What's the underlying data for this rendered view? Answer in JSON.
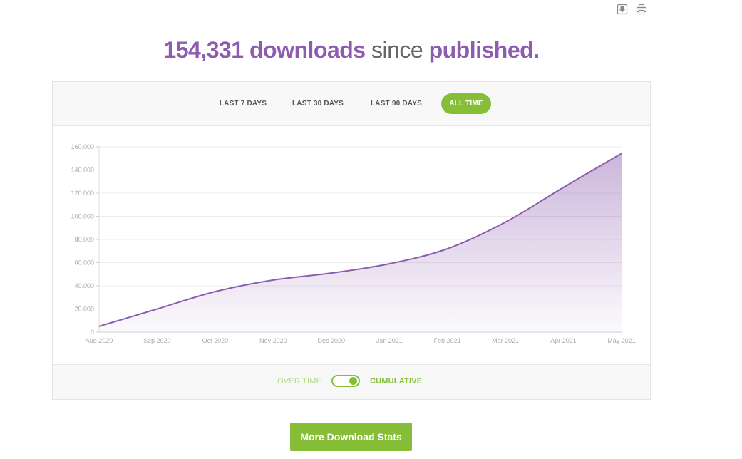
{
  "toolbar": {
    "icons": [
      "download-icon",
      "print-icon"
    ]
  },
  "headline": {
    "count": "154,331",
    "word_downloads": "downloads",
    "word_since": "since",
    "word_published": "published."
  },
  "tabs": [
    {
      "label": "LAST 7 DAYS",
      "active": false
    },
    {
      "label": "LAST 30 DAYS",
      "active": false
    },
    {
      "label": "LAST 90 DAYS",
      "active": false
    },
    {
      "label": "ALL TIME",
      "active": true
    }
  ],
  "toggle": {
    "left_label": "OVER TIME",
    "right_label": "CUMULATIVE",
    "state": "CUMULATIVE"
  },
  "button": {
    "label": "More Download Stats"
  },
  "colors": {
    "accent_green": "#86bf37",
    "series_purple": "#8d5cb0"
  },
  "chart_data": {
    "type": "area",
    "title": "",
    "xlabel": "",
    "ylabel": "",
    "ylim": [
      0,
      160000
    ],
    "yticks": [
      0,
      20000,
      40000,
      60000,
      80000,
      100000,
      120000,
      140000,
      160000
    ],
    "ytick_labels": [
      "0",
      "20.000",
      "40.000",
      "60.000",
      "80.000",
      "100.000",
      "120.000",
      "140.000",
      "160.000"
    ],
    "x_labels": [
      "Aug 2020",
      "Sep 2020",
      "Oct 2020",
      "Nov 2020",
      "Dec 2020",
      "Jan 2021",
      "Feb 2021",
      "Mar 2021",
      "Apr 2021",
      "May 2021"
    ],
    "grid": true,
    "legend": "none",
    "series": [
      {
        "x": [
          "Aug 2020",
          "Sep 2020",
          "Oct 2020",
          "Nov 2020",
          "Dec 2020",
          "Jan 2021",
          "Feb 2021",
          "Mar 2021",
          "Apr 2021",
          "May 2021"
        ],
        "values": [
          5000,
          20000,
          35000,
          45000,
          51000,
          59000,
          72000,
          95000,
          125000,
          154331
        ]
      }
    ]
  }
}
